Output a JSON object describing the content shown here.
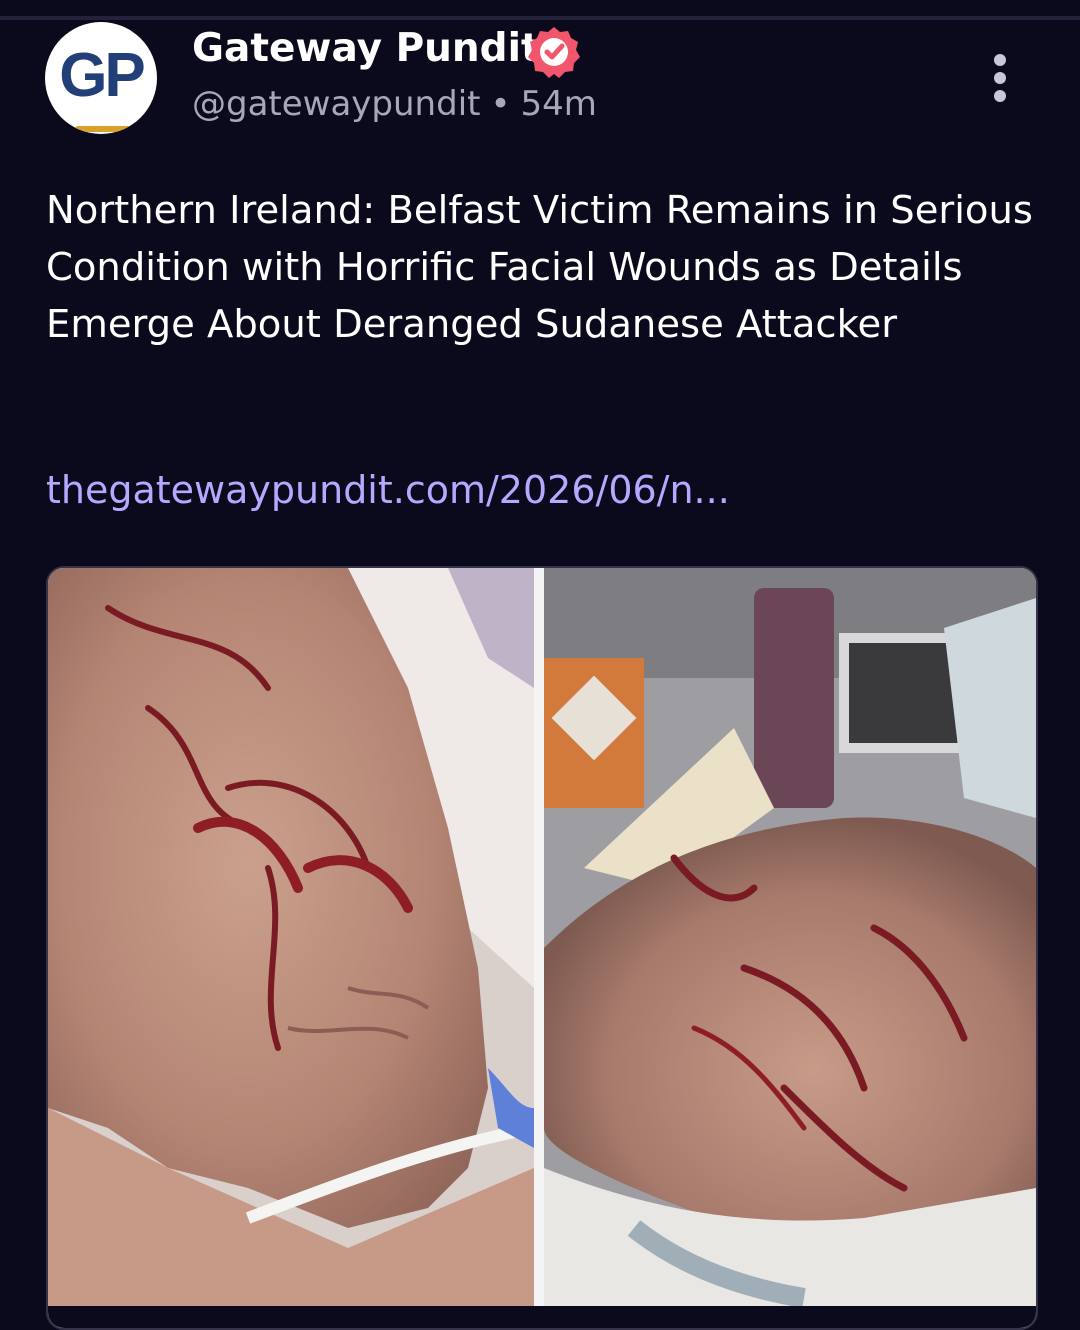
{
  "post": {
    "avatar_text": "GP",
    "display_name": "Gateway Pundit",
    "handle": "@gatewaypundit",
    "separator": "•",
    "time": "54m",
    "text": "Northern Ireland: Belfast Victim Remains in Serious Condition with Horrific Facial Wounds as Details Emerge About Deranged Sudanese Attacker",
    "link": "thegatewaypundit.com/2026/06/n..."
  },
  "icons": {
    "verified": "verified-badge-icon",
    "more": "more-vertical-icon"
  },
  "colors": {
    "background": "#0b0a1c",
    "link": "#b3a9ff",
    "verified_badge": "#f2566c",
    "secondary_text": "#a8a7b8"
  }
}
